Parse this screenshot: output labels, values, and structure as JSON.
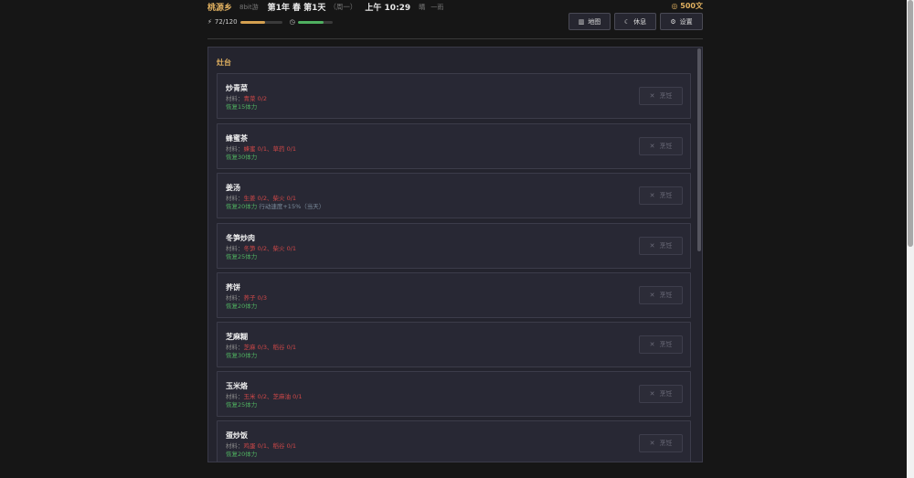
{
  "header": {
    "brand": "桃源乡",
    "tag": "8bit游",
    "date": "第1年 春 第1天",
    "weekday": "（周一）",
    "time": "上午 10:29",
    "weather_icon": "晴",
    "weather": "一雨",
    "money": "500文",
    "money_icon": "coin-icon",
    "stamina_text": "72/120",
    "stamina_fraction": 0.6,
    "time_fraction": 0.75,
    "stamina_color": "#d4a050",
    "time_color": "#4fb060"
  },
  "buttons": {
    "map": "地图",
    "rest": "休息",
    "settings": "设置"
  },
  "panel": {
    "title": "灶台",
    "cook_label": "烹饪",
    "material_prefix": "材料："
  },
  "recipes": [
    {
      "name": "炒青菜",
      "materials": "青菜 0/2",
      "effect": "恢复15体力",
      "extra": ""
    },
    {
      "name": "蜂蜜茶",
      "materials": "蜂蜜 0/1、草药 0/1",
      "effect": "恢复30体力",
      "extra": ""
    },
    {
      "name": "姜汤",
      "materials": "生姜 0/2、柴火 0/1",
      "effect": "恢复20体力",
      "extra": "行动速度+15%（当天）"
    },
    {
      "name": "冬笋炒肉",
      "materials": "冬笋 0/2、柴火 0/1",
      "effect": "恢复25体力",
      "extra": ""
    },
    {
      "name": "荞饼",
      "materials": "荞子 0/3",
      "effect": "恢复20体力",
      "extra": ""
    },
    {
      "name": "芝麻糊",
      "materials": "芝麻 0/3、稻谷 0/1",
      "effect": "恢复30体力",
      "extra": ""
    },
    {
      "name": "玉米烙",
      "materials": "玉米 0/2、芝麻油 0/1",
      "effect": "恢复25体力",
      "extra": ""
    },
    {
      "name": "蛋炒饭",
      "materials": "鸡蛋 0/1、稻谷 0/1",
      "effect": "恢复20体力",
      "extra": ""
    }
  ]
}
